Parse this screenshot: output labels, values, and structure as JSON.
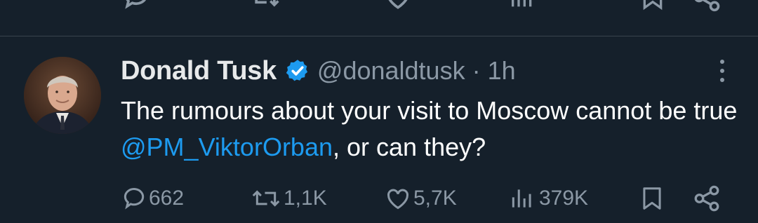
{
  "tweet": {
    "author_name": "Donald Tusk",
    "handle": "@donaldtusk",
    "separator": "·",
    "time": "1h",
    "text_before": "The rumours about your visit to Moscow cannot be true ",
    "mention": "@PM_ViktorOrban",
    "text_after": ", or can they?",
    "replies": "662",
    "reposts": "1,1K",
    "likes": "5,7K",
    "views": "379K"
  },
  "colors": {
    "background": "#15202b",
    "text": "#ffffff",
    "secondary": "#8b98a5",
    "accent": "#1d9bf0",
    "divider": "#38444d"
  },
  "icons": [
    "reply-icon",
    "repost-icon",
    "like-icon",
    "views-icon",
    "bookmark-icon",
    "share-icon",
    "verified-badge-icon",
    "more-icon"
  ]
}
